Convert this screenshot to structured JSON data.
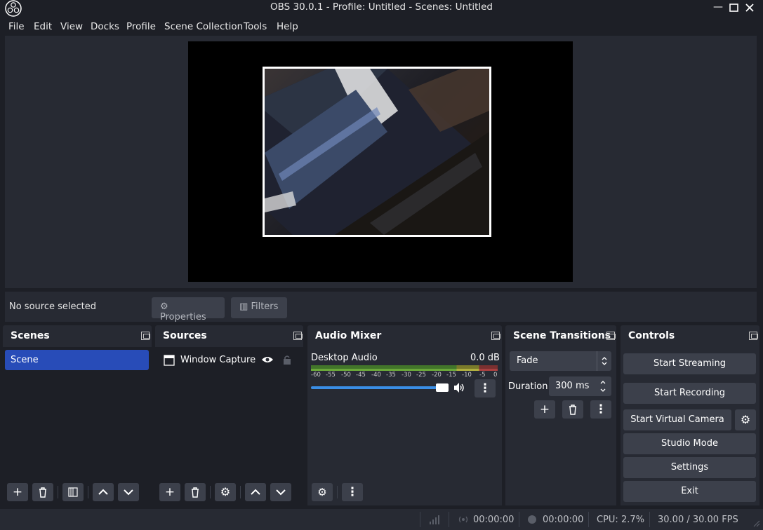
{
  "window": {
    "title": "OBS 30.0.1 - Profile: Untitled - Scenes: Untitled"
  },
  "menu": [
    "File",
    "Edit",
    "View",
    "Docks",
    "Profile",
    "Scene Collection",
    "Tools",
    "Help"
  ],
  "source_bar": {
    "status": "No source selected",
    "properties": "Properties",
    "filters": "Filters"
  },
  "scenes": {
    "title": "Scenes",
    "items": [
      "Scene"
    ]
  },
  "sources": {
    "title": "Sources",
    "items": [
      {
        "name": "Window Capture ("
      }
    ]
  },
  "audio": {
    "title": "Audio Mixer",
    "channel": "Desktop Audio",
    "level": "0.0 dB",
    "ticks": [
      "-60",
      "-55",
      "-50",
      "-45",
      "-40",
      "-35",
      "-30",
      "-25",
      "-20",
      "-15",
      "-10",
      "-5",
      "0"
    ],
    "volume_fraction": 1.0
  },
  "transitions": {
    "title": "Scene Transitions",
    "type": "Fade",
    "duration_label": "Duration",
    "duration": "300 ms"
  },
  "controls": {
    "title": "Controls",
    "start_streaming": "Start Streaming",
    "start_recording": "Start Recording",
    "start_virtual_camera": "Start Virtual Camera",
    "studio_mode": "Studio Mode",
    "settings": "Settings",
    "exit": "Exit"
  },
  "status": {
    "stream_time": "00:00:00",
    "record_time": "00:00:00",
    "cpu": "CPU: 2.7%",
    "fps": "30.00 / 30.00 FPS"
  },
  "colors": {
    "accent": "#284cb8",
    "panel": "#272a33",
    "background": "#1d1f26",
    "button": "#3c404b"
  }
}
